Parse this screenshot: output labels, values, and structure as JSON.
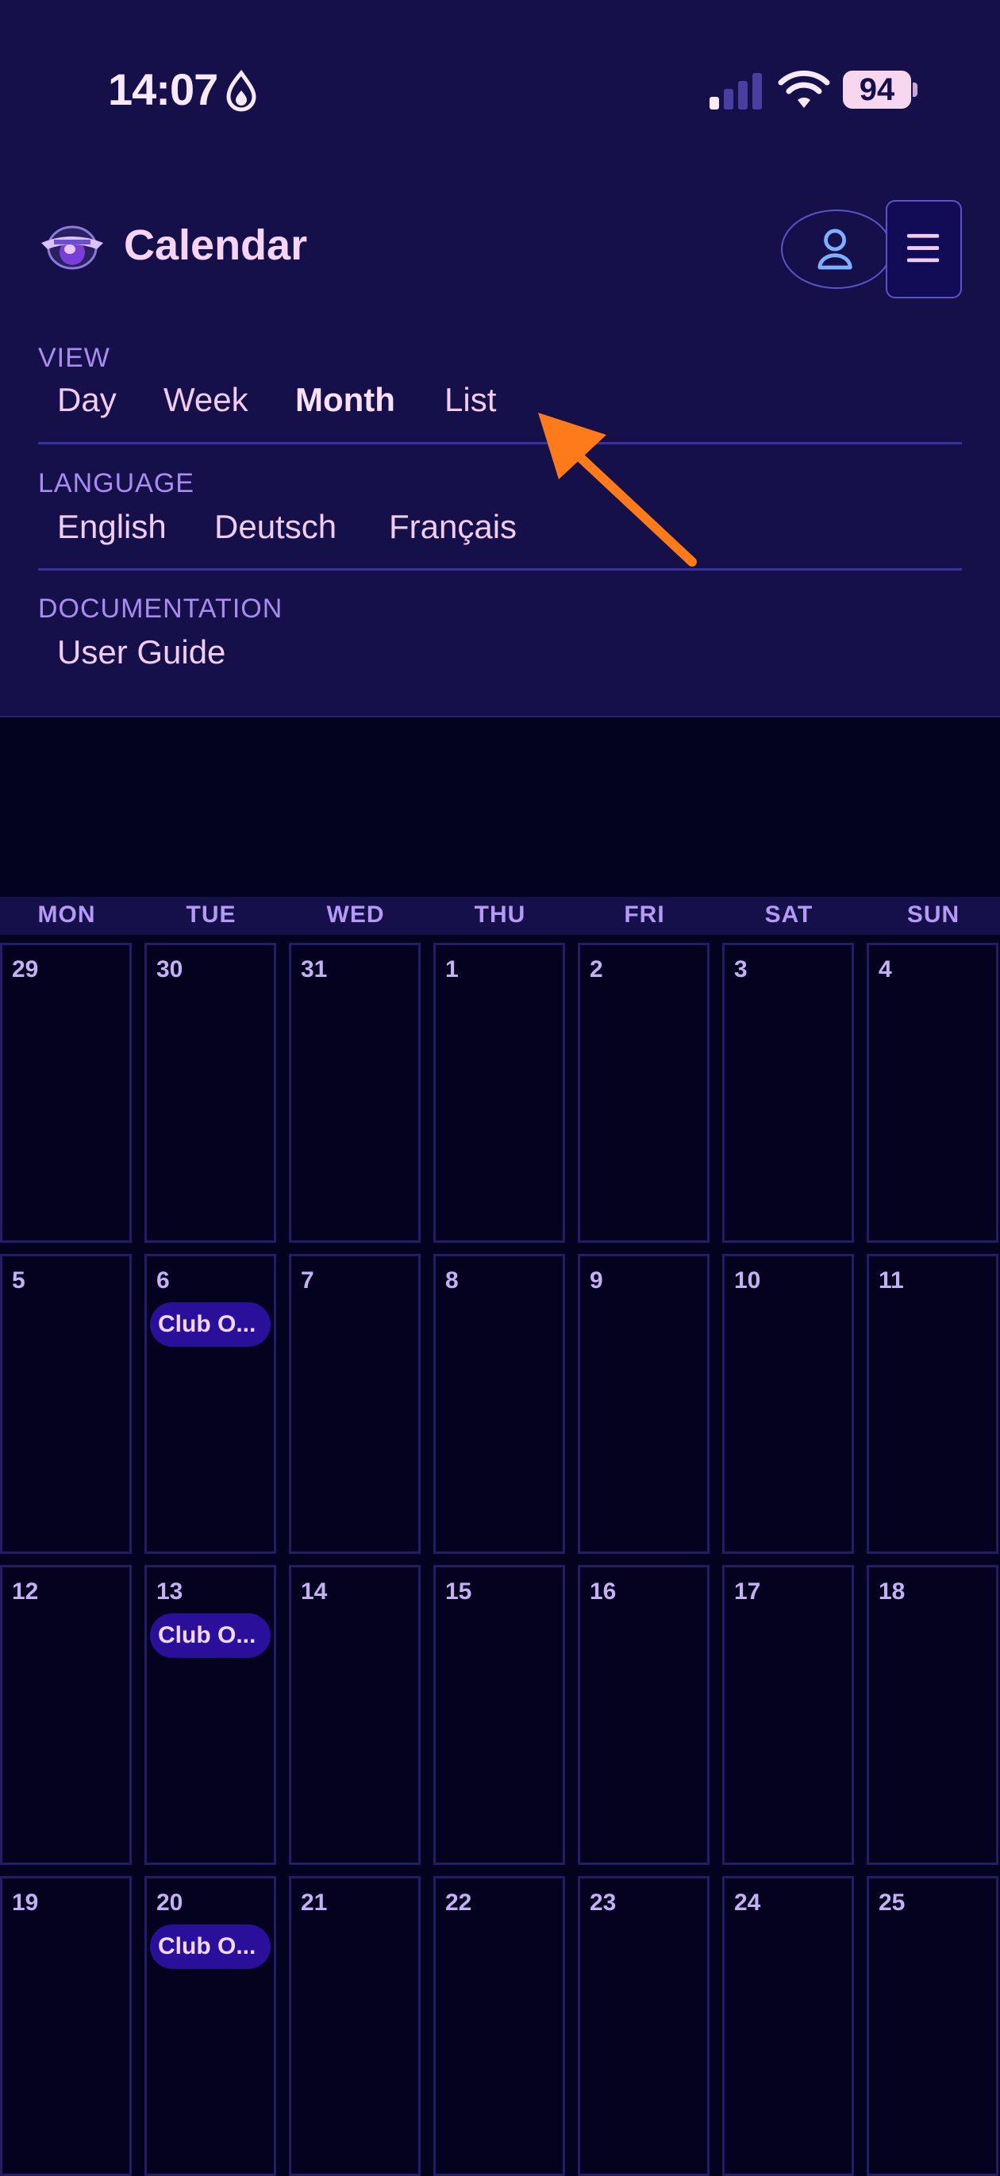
{
  "status_bar": {
    "time": "14:07",
    "battery": "94"
  },
  "app": {
    "title": "Calendar"
  },
  "menu": {
    "view": {
      "label": "VIEW",
      "items": [
        "Day",
        "Week",
        "Month",
        "List"
      ],
      "active": "Month"
    },
    "language": {
      "label": "LANGUAGE",
      "items": [
        "English",
        "Deutsch",
        "Français"
      ]
    },
    "documentation": {
      "label": "DOCUMENTATION",
      "items": [
        "User Guide"
      ]
    }
  },
  "calendar": {
    "weekdays": [
      "MON",
      "TUE",
      "WED",
      "THU",
      "FRI",
      "SAT",
      "SUN"
    ],
    "weeks": [
      [
        "29",
        "30",
        "31",
        "1",
        "2",
        "3",
        "4"
      ],
      [
        "5",
        "6",
        "7",
        "8",
        "9",
        "10",
        "11"
      ],
      [
        "12",
        "13",
        "14",
        "15",
        "16",
        "17",
        "18"
      ],
      [
        "19",
        "20",
        "21",
        "22",
        "23",
        "24",
        "25"
      ]
    ],
    "events": [
      {
        "week": 1,
        "day": 1,
        "title": "Club O..."
      },
      {
        "week": 2,
        "day": 1,
        "title": "Club O..."
      },
      {
        "week": 3,
        "day": 1,
        "title": "Club O..."
      }
    ]
  },
  "colors": {
    "header_bg": "#150f4a",
    "page_bg": "#03021f",
    "accent_purple": "#a98cf0",
    "event_bg": "#2a0f9a",
    "annotation_arrow": "#ff7a1a"
  }
}
